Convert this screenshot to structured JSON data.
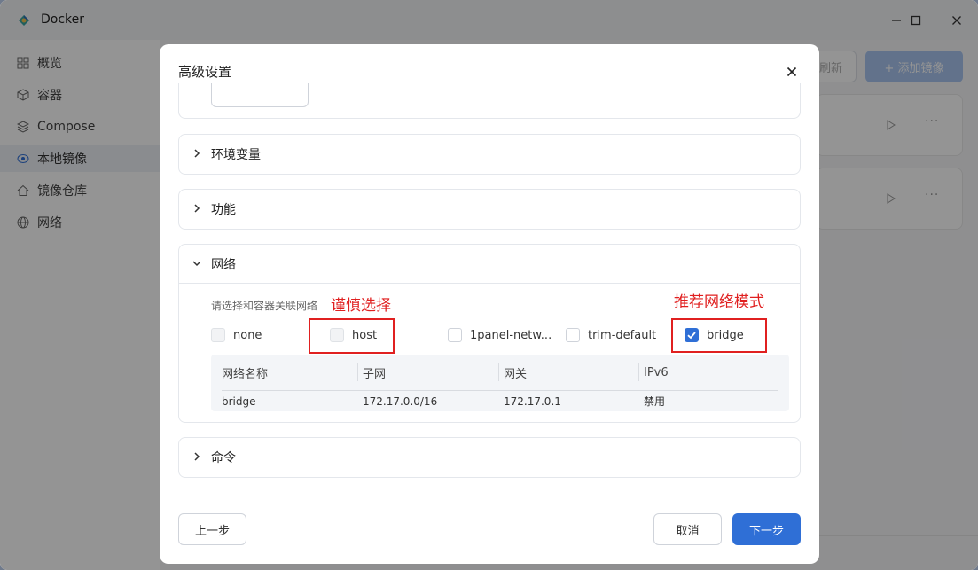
{
  "window": {
    "title": "Docker",
    "minimize": "—",
    "maximize": "☐",
    "close": "✕"
  },
  "sidebar": {
    "items": [
      {
        "label": "概览",
        "icon": "grid-icon"
      },
      {
        "label": "容器",
        "icon": "cube-icon"
      },
      {
        "label": "Compose",
        "icon": "layers-icon"
      },
      {
        "label": "本地镜像",
        "icon": "disc-icon",
        "active": true
      },
      {
        "label": "镜像仓库",
        "icon": "home-icon"
      },
      {
        "label": "网络",
        "icon": "globe-icon"
      }
    ]
  },
  "background": {
    "refresh_label": "刷新",
    "add_image_label": "+ 添加镜像",
    "card_more": "···"
  },
  "dialog": {
    "title": "高级设置",
    "sections": {
      "env": "环境变量",
      "features": "功能",
      "network": "网络",
      "command": "命令"
    },
    "network": {
      "hint": "请选择和容器关联网络",
      "options": [
        {
          "label": "none",
          "checked": false,
          "disabled": true
        },
        {
          "label": "host",
          "checked": false,
          "disabled": true
        },
        {
          "label": "1panel-netw...",
          "checked": false,
          "disabled": false
        },
        {
          "label": "trim-default",
          "checked": false,
          "disabled": false
        },
        {
          "label": "bridge",
          "checked": true,
          "disabled": false
        }
      ],
      "table": {
        "headers": [
          "网络名称",
          "子网",
          "网关",
          "IPv6"
        ],
        "rows": [
          [
            "bridge",
            "172.17.0.0/16",
            "172.17.0.1",
            "禁用"
          ]
        ]
      }
    },
    "buttons": {
      "prev": "上一步",
      "cancel": "取消",
      "next": "下一步"
    }
  },
  "annotations": {
    "host_warning": "谨慎选择",
    "bridge_recommend": "推荐网络模式"
  },
  "colors": {
    "primary": "#2f6fd6",
    "annotation": "#e02020"
  }
}
